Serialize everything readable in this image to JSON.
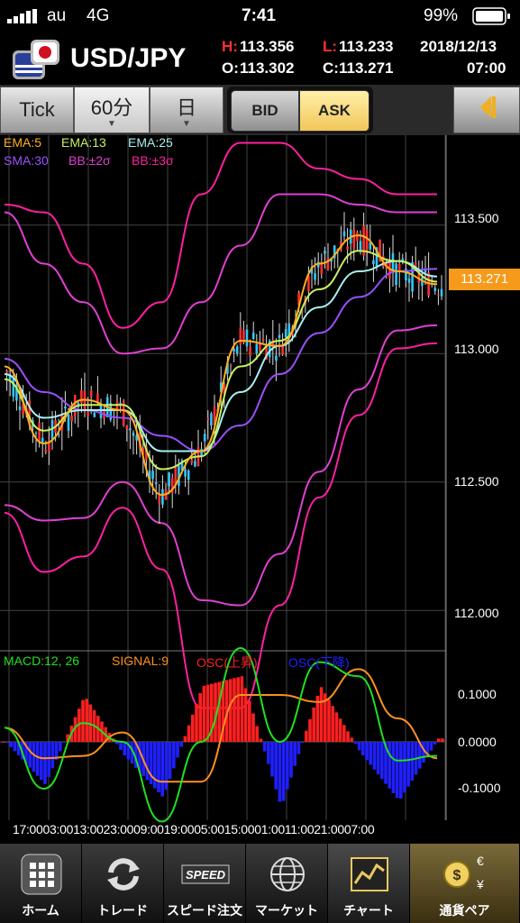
{
  "status_bar": {
    "carrier": "au",
    "network": "4G",
    "time": "7:41",
    "battery": "99%"
  },
  "header": {
    "pair": "USD/JPY",
    "high_label": "H:",
    "high": "113.356",
    "low_label": "L:",
    "low": "113.233",
    "open_label": "O:",
    "open": "113.302",
    "close_label": "C:",
    "close": "113.271",
    "date": "2018/12/13",
    "time": "07:00"
  },
  "toolbar": {
    "tick": "Tick",
    "min60": "60分",
    "day": "日",
    "bid": "BID",
    "ask": "ASK",
    "selected": "ASK"
  },
  "legend": {
    "ema5": "EMA:5",
    "ema13": "EMA:13",
    "ema25": "EMA:25",
    "sma30": "SMA:30",
    "bb2": "BB:±2σ",
    "bb3": "BB:±3σ"
  },
  "macd_legend": {
    "macd": "MACD:12, 26",
    "signal": "SIGNAL:9",
    "osc_up": "OSC(上昇)",
    "osc_down": "OSC(下降)"
  },
  "price_axis": [
    "113.500",
    "113.000",
    "112.500",
    "112.000"
  ],
  "current_price": "113.271",
  "macd_axis": [
    "0.1000",
    "0.0000",
    "-0.1000"
  ],
  "time_axis": "17:0003:0013:0023:0009:0019:0005:0015:0001:0011:0021:0007:00",
  "colors": {
    "ema5": "#ffb020",
    "ema13": "#c8f060",
    "ema25": "#a8f0f0",
    "sma30": "#9a50ff",
    "bb2": "#e040d0",
    "bb3": "#ff20a0",
    "macd": "#20e020",
    "signal": "#ff9020",
    "osc_up": "#ff2020",
    "osc_down": "#2020ff",
    "price_tag": "#f59a1a",
    "high": "#ff3030",
    "low": "#ff3030"
  },
  "tabs": [
    {
      "label": "ホーム",
      "icon": "home-grid-icon"
    },
    {
      "label": "トレード",
      "icon": "trade-arrows-icon"
    },
    {
      "label": "スピード注文",
      "icon": "speed-icon"
    },
    {
      "label": "マーケット",
      "icon": "globe-icon"
    },
    {
      "label": "チャート",
      "icon": "chart-icon"
    },
    {
      "label": "通貨ペア",
      "icon": "currency-icon"
    }
  ],
  "chart_data": {
    "type": "line",
    "x": [
      "17:00",
      "03:00",
      "13:00",
      "23:00",
      "09:00",
      "19:00",
      "05:00",
      "15:00",
      "01:00",
      "11:00",
      "21:00",
      "07:00"
    ],
    "ylim": [
      111.85,
      113.85
    ],
    "series": [
      {
        "name": "EMA:5",
        "values": [
          112.95,
          112.65,
          112.82,
          112.78,
          112.45,
          112.62,
          113.05,
          113.03,
          113.35,
          113.46,
          113.32,
          113.27
        ]
      },
      {
        "name": "EMA:13",
        "values": [
          112.9,
          112.7,
          112.8,
          112.8,
          112.55,
          112.6,
          112.95,
          113.05,
          113.25,
          113.4,
          113.36,
          113.28
        ]
      },
      {
        "name": "EMA:25",
        "values": [
          112.92,
          112.75,
          112.78,
          112.78,
          112.62,
          112.62,
          112.85,
          113.03,
          113.18,
          113.32,
          113.36,
          113.3
        ]
      },
      {
        "name": "SMA:30",
        "values": [
          112.98,
          112.85,
          112.78,
          112.75,
          112.68,
          112.62,
          112.72,
          112.92,
          113.08,
          113.22,
          113.32,
          113.33
        ]
      },
      {
        "name": "BB:±2σ",
        "values": [
          113.55,
          113.35,
          113.2,
          113.0,
          113.02,
          113.2,
          113.42,
          113.62,
          113.62,
          113.58,
          113.55,
          113.55
        ]
      },
      {
        "name": "BB:±3σ",
        "values": [
          113.58,
          113.55,
          113.35,
          113.1,
          113.2,
          113.62,
          113.82,
          113.82,
          113.72,
          113.68,
          113.62,
          113.62
        ]
      }
    ]
  }
}
